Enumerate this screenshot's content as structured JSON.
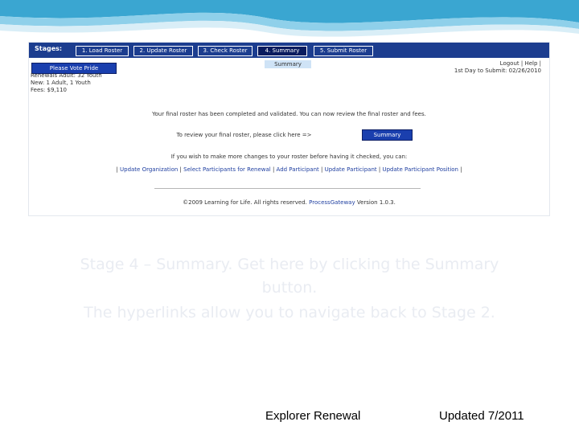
{
  "stages": {
    "label": "Stages:",
    "items": [
      "1. Load Roster",
      "2. Update Roster",
      "3. Check Roster",
      "4. Summary",
      "5. Submit Roster"
    ],
    "active_index": 3
  },
  "top": {
    "plate_button": "Please Vote Pride",
    "summary_tab": "Summary",
    "info_lines": [
      "Renewals Adult: 32 Youth",
      "New: 1 Adult, 1 Youth",
      "Fees: $9,110"
    ],
    "right_lines": [
      "Logout | Help |",
      "1st Day to Submit: 02/26/2010"
    ]
  },
  "main": {
    "msg1": "Your final roster has been completed and validated. You can now review the final roster and fees.",
    "msg2": "To review your final roster, please click here =>",
    "summary_button": "Summary",
    "msg3": "If you wish to make more changes to your roster before having it checked, you can:",
    "links": [
      "Update Organization",
      "Select Participants for Renewal",
      "Add Participant",
      "Update Participant",
      "Update Participant Position"
    ],
    "copyright_prefix": "©2009 Learning for Life. All rights reserved.",
    "copyright_link": "ProcessGateway",
    "copyright_suffix": "Version 1.0.3."
  },
  "caption": {
    "line1": "Stage 4 – Summary. Get here by clicking the Summary",
    "line2": "button.",
    "line3": "The hyperlinks allow you to navigate back to Stage 2."
  },
  "footer": {
    "title": "Explorer Renewal",
    "updated": "Updated 7/2011"
  }
}
